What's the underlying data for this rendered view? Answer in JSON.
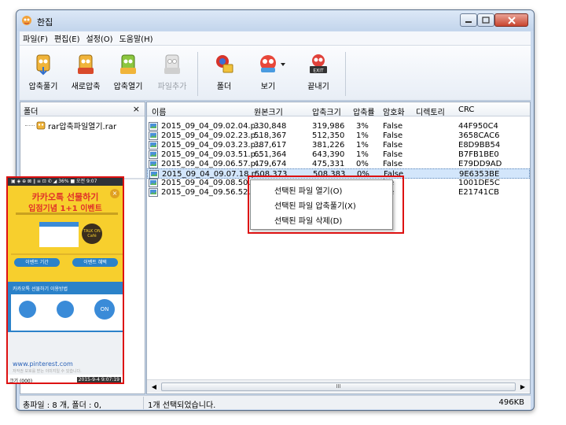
{
  "window": {
    "title": "한집"
  },
  "menubar": [
    {
      "label": "파일(F)"
    },
    {
      "label": "편집(E)"
    },
    {
      "label": "설정(O)"
    },
    {
      "label": "도움말(H)"
    }
  ],
  "toolbar": {
    "extract": "압축풀기",
    "new_archive": "새로압축",
    "open_archive": "압축열기",
    "add_file": "파일추가",
    "folder": "폴더",
    "view": "보기",
    "exit": "끝내기",
    "exit_badge": "EXIT"
  },
  "left_pane": {
    "title": "폴더",
    "close_glyph": "×",
    "tree_item": "rar압축파일열기.rar"
  },
  "preview": {
    "status_text": "▣ ◈ ⊕ ⊠ ∥ ≡   ⊡ ✆ ◢ 36% ■ 오전 9:07",
    "ad_title": "카카오톡 선물하기",
    "ad_subtitle": "입점기념 1+1 이벤트",
    "talk_badge": "TALK ON Café",
    "event_left": "이벤트 기간",
    "event_right": "이벤트 혜택",
    "section_title": "카카오톡 선물하기 이용방법",
    "step_on": "ON",
    "url": "www.pinterest.com",
    "small_text": "저작권 보호를 받는 이미지일 수 있습니다.",
    "bottom_left": "크기 (000)",
    "bottom_right": "2015-9-4 9:07:19"
  },
  "list": {
    "columns": [
      "이름",
      "원본크기",
      "압축크기",
      "압축률",
      "암호화",
      "디렉토리",
      "CRC"
    ],
    "rows": [
      {
        "name": "2015_09_04_09.02.04.p...",
        "orig": "330,848",
        "comp": "319,986",
        "ratio": "3%",
        "enc": "False",
        "dir": "",
        "crc": "44F950C4",
        "selected": false
      },
      {
        "name": "2015_09_04_09.02.23.p...",
        "orig": "518,367",
        "comp": "512,350",
        "ratio": "1%",
        "enc": "False",
        "dir": "",
        "crc": "3658CAC6",
        "selected": false
      },
      {
        "name": "2015_09_04_09.03.23.p...",
        "orig": "387,617",
        "comp": "381,226",
        "ratio": "1%",
        "enc": "False",
        "dir": "",
        "crc": "E8D9BB54",
        "selected": false
      },
      {
        "name": "2015_09_04_09.03.51.p...",
        "orig": "651,364",
        "comp": "643,390",
        "ratio": "1%",
        "enc": "False",
        "dir": "",
        "crc": "B7FB1BE0",
        "selected": false
      },
      {
        "name": "2015_09_04_09.06.57.p...",
        "orig": "479,674",
        "comp": "475,331",
        "ratio": "0%",
        "enc": "False",
        "dir": "",
        "crc": "E79DD9AD",
        "selected": false
      },
      {
        "name": "2015_09_04_09.07.18.p...",
        "orig": "508,373",
        "comp": "508,383",
        "ratio": "0%",
        "enc": "False",
        "dir": "",
        "crc": "9E6353BE",
        "selected": true
      },
      {
        "name": "2015_09_04_09.08.50.p...",
        "orig": "",
        "comp": "",
        "ratio": "",
        "enc": "lse",
        "dir": "",
        "crc": "1001DE5C",
        "selected": false
      },
      {
        "name": "2015_09_04_09.56.52.p...",
        "orig": "",
        "comp": "",
        "ratio": "",
        "enc": "lse",
        "dir": "",
        "crc": "E21741CB",
        "selected": false
      }
    ],
    "hscroll_grip": "III"
  },
  "context_menu": [
    {
      "label": "선택된 파일 열기(O)"
    },
    {
      "label": "선택된 파일 압축풀기(X)"
    },
    {
      "label": "선택된 파일 삭제(D)"
    }
  ],
  "statusbar": {
    "left": "총파일 : 8 개, 폴더 : 0,",
    "middle": "1개 선택되었습니다.",
    "right": "496KB"
  },
  "colors": {
    "accent": "#d11111",
    "selection": "#d3e6fb",
    "window_frame": "#c9d9ee"
  }
}
